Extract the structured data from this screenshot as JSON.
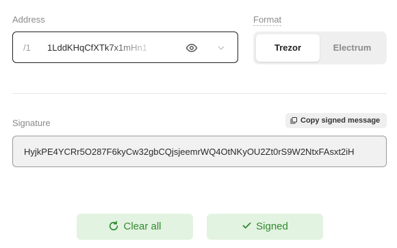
{
  "address": {
    "label": "Address",
    "prefix": "/1",
    "value": "1LddKHqCfXTk7x1mHn1",
    "show_icon": "eye-icon",
    "dropdown_icon": "chevron-down-icon"
  },
  "format": {
    "label": "Format",
    "options": [
      "Trezor",
      "Electrum"
    ],
    "selected": "Trezor"
  },
  "signature": {
    "label": "Signature",
    "copy_label": "Copy signed message",
    "copy_icon": "copy-icon",
    "value": "HyjkPE4YCRr5O287F6kyCw32gbCQjsjeemrWQ4OtNKyOU2Zt0rS9W2NtxFAsxt2iH"
  },
  "actions": {
    "clear_label": "Clear all",
    "clear_icon": "refresh-icon",
    "signed_label": "Signed",
    "signed_icon": "checkmark-icon"
  },
  "colors": {
    "accent_bg": "#e3f3e1",
    "accent_text": "#2f8a2f"
  }
}
